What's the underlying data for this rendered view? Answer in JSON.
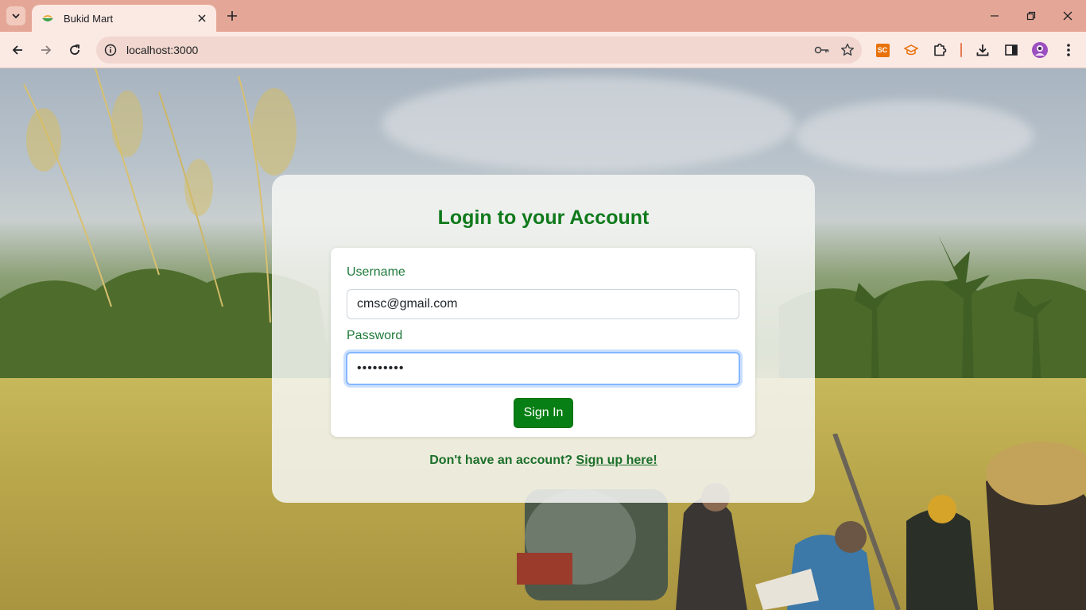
{
  "browser": {
    "tab_title": "Bukid Mart",
    "url": "localhost:3000",
    "icons": {
      "tab_search": "chevron-down-icon",
      "tab_close": "close-icon",
      "new_tab": "plus-icon",
      "minimize": "minimize-icon",
      "restore": "restore-icon",
      "close_window": "close-icon",
      "back": "back-arrow-icon",
      "forward": "forward-arrow-icon",
      "reload": "reload-icon",
      "site_info": "info-icon",
      "password_key": "key-icon",
      "bookmark": "star-icon",
      "extensions": "puzzle-icon",
      "downloads": "download-icon",
      "side_panel": "side-panel-icon",
      "profile": "avatar",
      "menu": "more-vertical-icon"
    },
    "extensions": [
      "SC",
      "graduation-cap"
    ]
  },
  "login": {
    "title": "Login to your Account",
    "username_label": "Username",
    "username_value": "cmsc@gmail.com",
    "password_label": "Password",
    "password_value": "•••••••••",
    "submit_label": "Sign In",
    "signup_prompt": "Don't have an account?",
    "signup_link": "Sign up here!"
  },
  "colors": {
    "accent_green": "#087f14",
    "title_green": "#0f7a1b",
    "chrome_bg": "#e4a797",
    "toolbar_bg": "#fbe9e4"
  }
}
